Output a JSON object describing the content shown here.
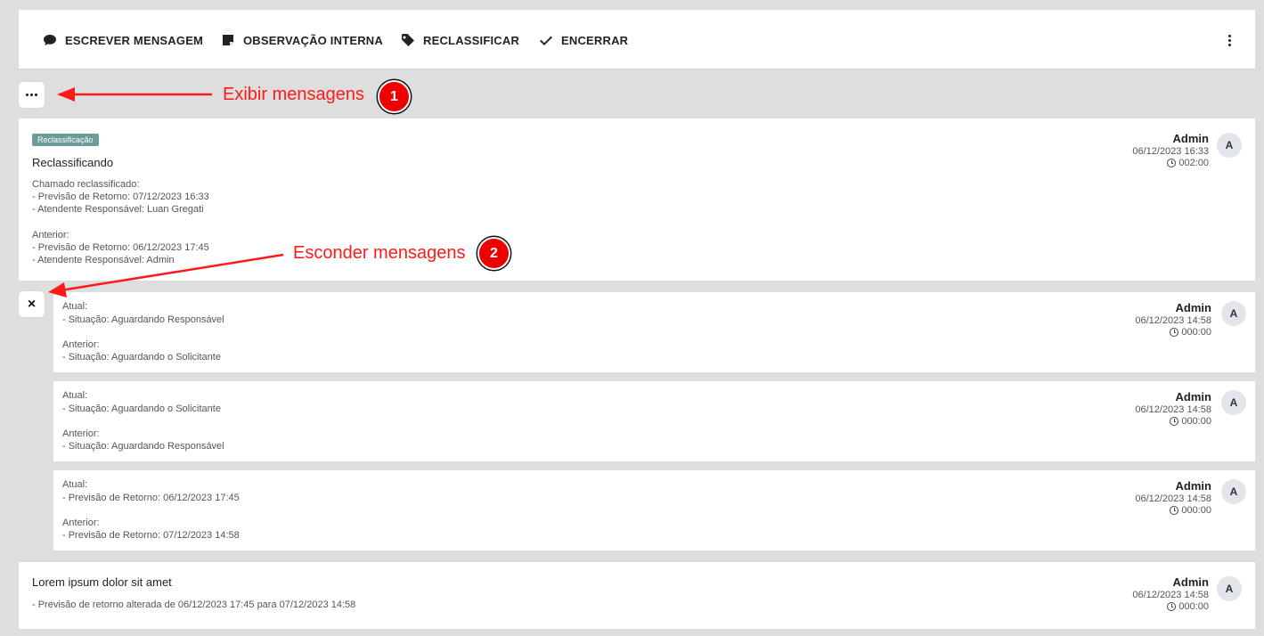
{
  "toolbar": {
    "write_message": "ESCREVER MENSAGEM",
    "internal_note": "OBSERVAÇÃO INTERNA",
    "reclassify": "RECLASSIFICAR",
    "close": "ENCERRAR"
  },
  "annotations": {
    "show_messages": "Exibir mensagens",
    "show_number": "1",
    "hide_messages": "Esconder mensagens",
    "hide_number": "2"
  },
  "reclass_card": {
    "badge": "Reclassificação",
    "title": "Reclassificando",
    "lines": [
      "Chamado reclassificado:",
      "- Previsão de Retorno: 07/12/2023 16:33",
      "- Atendente Responsável: Luan Gregati",
      "Anterior:",
      "- Previsão de Retorno: 06/12/2023 17:45",
      "- Atendente Responsável: Admin"
    ],
    "author": "Admin",
    "date": "06/12/2023 16:33",
    "duration": "002:00",
    "avatar": "A"
  },
  "sub_cards": [
    {
      "current_label": "Atual:",
      "current_value": "- Situação: Aguardando Responsável",
      "previous_label": "Anterior:",
      "previous_value": "- Situação: Aguardando o Solicitante",
      "author": "Admin",
      "date": "06/12/2023 14:58",
      "duration": "000:00",
      "avatar": "A"
    },
    {
      "current_label": "Atual:",
      "current_value": "- Situação: Aguardando o Solicitante",
      "previous_label": "Anterior:",
      "previous_value": "- Situação: Aguardando Responsável",
      "author": "Admin",
      "date": "06/12/2023 14:58",
      "duration": "000:00",
      "avatar": "A"
    },
    {
      "current_label": "Atual:",
      "current_value": "- Previsão de Retorno: 06/12/2023 17:45",
      "previous_label": "Anterior:",
      "previous_value": "- Previsão de Retorno: 07/12/2023 14:58",
      "author": "Admin",
      "date": "06/12/2023 14:58",
      "duration": "000:00",
      "avatar": "A"
    }
  ],
  "last_card": {
    "title": "Lorem ipsum dolor sit amet",
    "line": "- Previsão de retorno alterada de 06/12/2023 17:45 para 07/12/2023 14:58",
    "author": "Admin",
    "date": "06/12/2023 14:58",
    "duration": "000:00",
    "avatar": "A"
  },
  "colors": {
    "annotation_red": "#ff1a1a",
    "badge_teal": "#6c9c98",
    "background": "#dedede"
  }
}
